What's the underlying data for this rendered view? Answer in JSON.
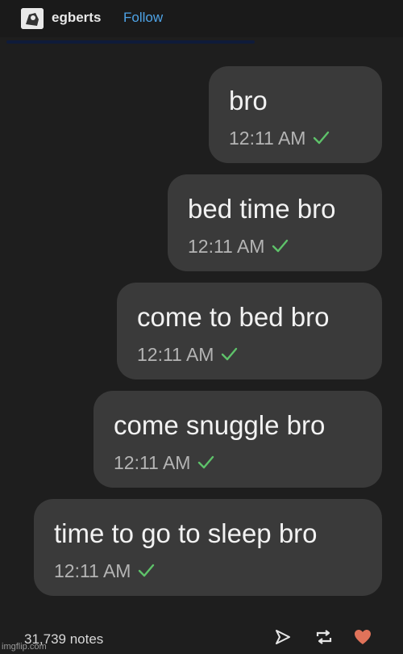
{
  "header": {
    "username": "egberts",
    "follow_label": "Follow"
  },
  "messages": [
    {
      "text": "bro",
      "time": "12:11 AM",
      "status": "check-icon"
    },
    {
      "text": "bed time bro",
      "time": "12:11 AM",
      "status": "check-icon"
    },
    {
      "text": "come to bed bro",
      "time": "12:11 AM",
      "status": "check-icon"
    },
    {
      "text": "come snuggle bro",
      "time": "12:11 AM",
      "status": "check-icon"
    },
    {
      "text": "time to go to sleep bro",
      "time": "12:11 AM",
      "status": "check-icon"
    }
  ],
  "footer": {
    "notes": "31,739 notes",
    "watermark": "imgflip.com",
    "icons": [
      "send-icon",
      "reblog-icon",
      "heart-icon"
    ]
  },
  "colors": {
    "background": "#1e1e1e",
    "bubble": "#3a3a3a",
    "follow": "#4ea3e6",
    "check": "#5ec26a",
    "heart": "#e0735a"
  }
}
